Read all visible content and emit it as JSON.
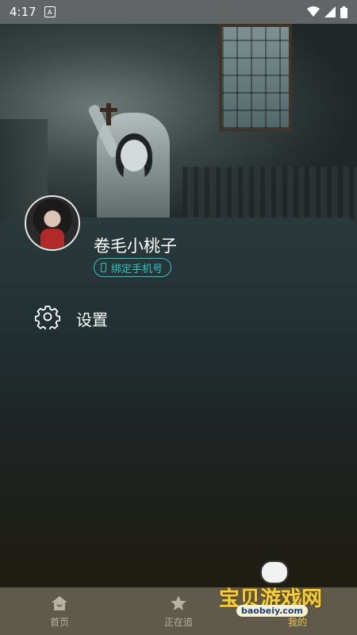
{
  "status_bar": {
    "time": "4:17",
    "app_badge": "A"
  },
  "profile": {
    "username": "卷毛小桃子",
    "bind_phone_label": "绑定手机号"
  },
  "menu": {
    "settings_label": "设置"
  },
  "tabs": [
    {
      "label": "首页",
      "icon": "home-icon",
      "active": false
    },
    {
      "label": "正在追",
      "icon": "star-icon",
      "active": false
    },
    {
      "label": "我的",
      "icon": "user-icon",
      "active": true
    }
  ],
  "watermark": {
    "text": "宝贝游戏网",
    "domain": "baobeiy.com"
  },
  "colors": {
    "accent": "#2fc7c2",
    "tab_active": "#e6c34c",
    "tab_bar": "#605a4a"
  }
}
